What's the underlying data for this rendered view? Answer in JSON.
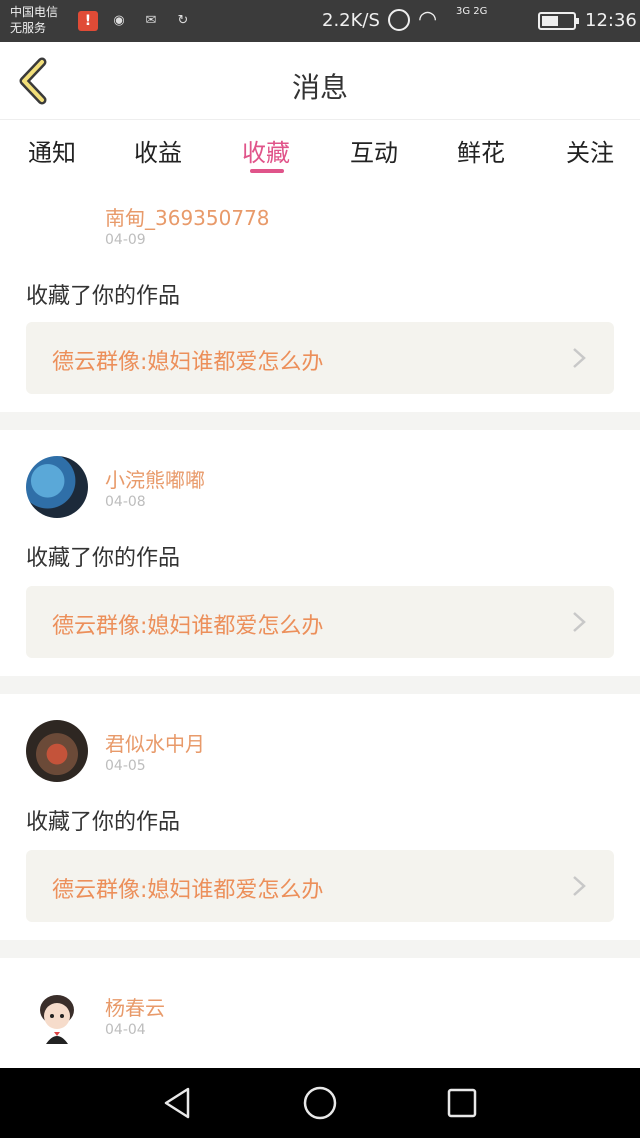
{
  "status_bar": {
    "carrier_line1": "中国电信",
    "carrier_line2": "无服务",
    "net_speed": "2.2K/S",
    "network_types": "3G 2G",
    "time": "12:36",
    "icons": [
      "alert-icon",
      "weibo-icon",
      "mail-icon",
      "sync-icon",
      "alarm-icon",
      "wifi-icon",
      "signal-icon",
      "battery-icon"
    ]
  },
  "header": {
    "title": "消息",
    "back_icon": "chevron-left-icon"
  },
  "tabs": [
    {
      "label": "通知",
      "active": false
    },
    {
      "label": "收益",
      "active": false
    },
    {
      "label": "收藏",
      "active": true
    },
    {
      "label": "互动",
      "active": false
    },
    {
      "label": "鲜花",
      "active": false
    },
    {
      "label": "关注",
      "active": false
    }
  ],
  "messages": [
    {
      "username": "南甸_369350778",
      "date": "04-09",
      "action": "收藏了你的作品",
      "work_title": "德云群像:媳妇谁都爱怎么办"
    },
    {
      "username": "小浣熊嘟嘟",
      "date": "04-08",
      "action": "收藏了你的作品",
      "work_title": "德云群像:媳妇谁都爱怎么办"
    },
    {
      "username": "君似水中月",
      "date": "04-05",
      "action": "收藏了你的作品",
      "work_title": "德云群像:媳妇谁都爱怎么办"
    },
    {
      "username": "杨春云",
      "date": "04-04"
    }
  ],
  "colors": {
    "accent": "#e0548a",
    "username": "#e89a6a",
    "work_title": "#ec8f5a",
    "box_bg": "#f4f3ee"
  },
  "nav_bar": {
    "icons": [
      "back-triangle-icon",
      "home-circle-icon",
      "recents-square-icon"
    ]
  }
}
